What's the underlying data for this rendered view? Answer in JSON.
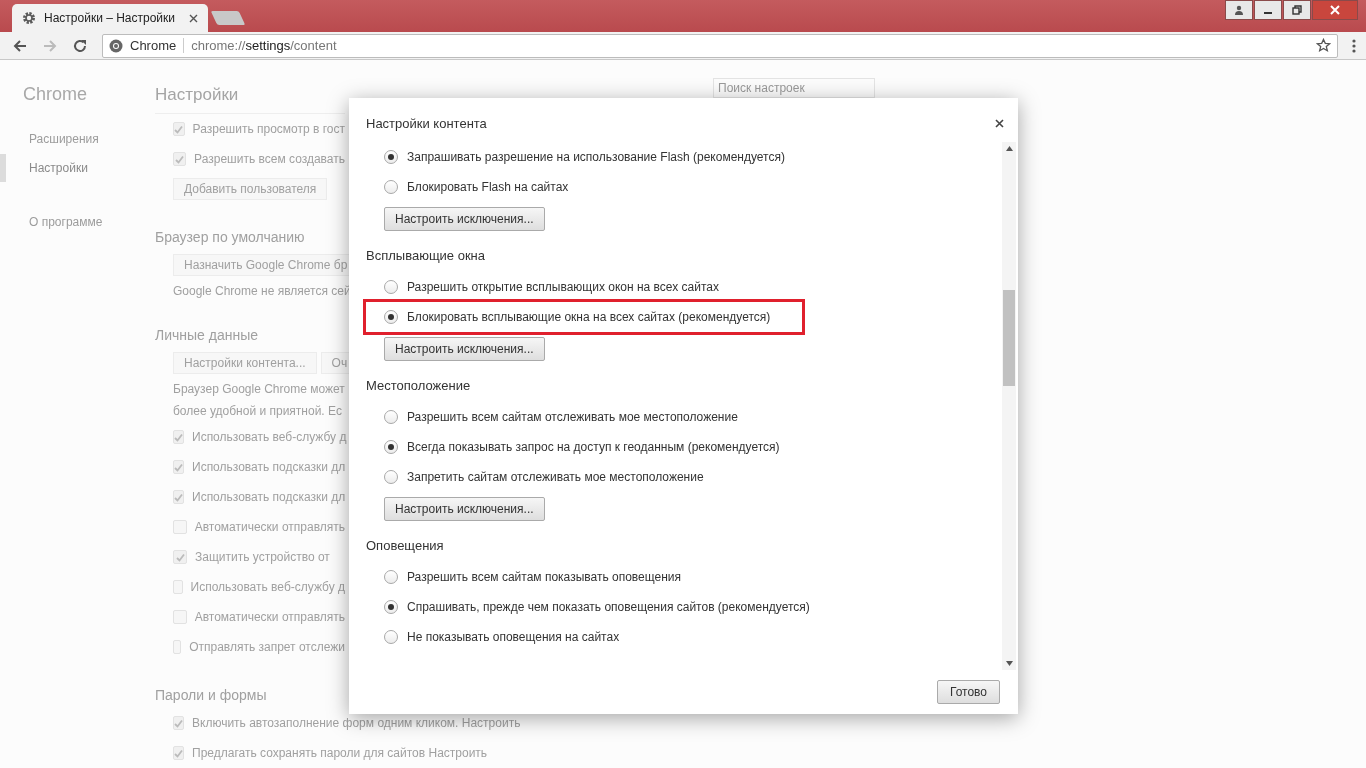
{
  "browser": {
    "tabs": [
      {
        "title": "Настройки – Настройки",
        "selected": true
      }
    ],
    "address_bar": {
      "site_label": "Chrome",
      "url_scheme": "chrome://",
      "url_host": "settings",
      "url_path": "/content"
    }
  },
  "sidebar": {
    "title": "Chrome",
    "items": [
      {
        "label": "Расширения",
        "selected": false
      },
      {
        "label": "Настройки",
        "selected": true
      },
      {
        "label": "О программе",
        "selected": false
      }
    ]
  },
  "settings_page": {
    "title": "Настройки",
    "search_placeholder": "Поиск настроек",
    "blocks": [
      {
        "kind": "checkbox",
        "label": "Разрешить просмотр в гост",
        "checked": true
      },
      {
        "kind": "checkbox",
        "label": "Разрешить всем создавать",
        "checked": true
      },
      {
        "kind": "buttons",
        "buttons": [
          "Добавить пользователя"
        ]
      },
      {
        "kind": "heading",
        "text": "Браузер по умолчанию"
      },
      {
        "kind": "buttons",
        "buttons": [
          "Назначить Google Chrome бр"
        ]
      },
      {
        "kind": "text",
        "text": "Google Chrome не является сей"
      },
      {
        "kind": "heading",
        "text": "Личные данные"
      },
      {
        "kind": "buttons",
        "buttons": [
          "Настройки контента...",
          "Оч"
        ]
      },
      {
        "kind": "text",
        "text": "Браузер Google Chrome может"
      },
      {
        "kind": "text",
        "text": "более удобной и приятной. Ес"
      },
      {
        "kind": "checkbox",
        "label": "Использовать веб-службу д",
        "checked": true
      },
      {
        "kind": "checkbox",
        "label": "Использовать подсказки дл",
        "checked": true
      },
      {
        "kind": "checkbox",
        "label": "Использовать подсказки дл",
        "checked": true
      },
      {
        "kind": "checkbox",
        "label": "Автоматически отправлять",
        "checked": false
      },
      {
        "kind": "checkbox",
        "label": "Защитить устройство от",
        "checked": true
      },
      {
        "kind": "checkbox",
        "label": "Использовать веб-службу д",
        "checked": false
      },
      {
        "kind": "checkbox",
        "label": "Автоматически отправлять",
        "checked": false
      },
      {
        "kind": "checkbox",
        "label": "Отправлять запрет отслежи",
        "checked": false
      },
      {
        "kind": "heading",
        "text": "Пароли и формы"
      },
      {
        "kind": "checkbox",
        "label": "Включить автозаполнение форм одним кликом. Настроить",
        "checked": true
      },
      {
        "kind": "checkbox",
        "label": "Предлагать сохранять пароли для сайтов Настроить",
        "checked": true
      }
    ]
  },
  "dialog": {
    "title": "Настройки контента",
    "sections": [
      {
        "options": [
          {
            "label": "Запрашивать разрешение на использование Flash (рекомендуется)",
            "selected": true,
            "highlighted": false
          },
          {
            "label": "Блокировать Flash на сайтах",
            "selected": false,
            "highlighted": false
          }
        ],
        "button": "Настроить исключения..."
      },
      {
        "heading": "Всплывающие окна",
        "options": [
          {
            "label": "Разрешить открытие всплывающих окон на всех сайтах",
            "selected": false,
            "highlighted": false
          },
          {
            "label": "Блокировать всплывающие окна на всех сайтах (рекомендуется)",
            "selected": true,
            "highlighted": true
          }
        ],
        "button": "Настроить исключения..."
      },
      {
        "heading": "Местоположение",
        "options": [
          {
            "label": "Разрешить всем сайтам отслеживать мое местоположение",
            "selected": false,
            "highlighted": false
          },
          {
            "label": "Всегда показывать запрос на доступ к геоданным (рекомендуется)",
            "selected": true,
            "highlighted": false
          },
          {
            "label": "Запретить сайтам отслеживать мое местоположение",
            "selected": false,
            "highlighted": false
          }
        ],
        "button": "Настроить исключения..."
      },
      {
        "heading": "Оповещения",
        "options": [
          {
            "label": "Разрешить всем сайтам показывать оповещения",
            "selected": false,
            "highlighted": false
          },
          {
            "label": "Спрашивать, прежде чем показать оповещения сайтов (рекомендуется)",
            "selected": true,
            "highlighted": false
          },
          {
            "label": "Не показывать оповещения на сайтах",
            "selected": false,
            "highlighted": false
          }
        ]
      }
    ],
    "done_button": "Готово"
  }
}
